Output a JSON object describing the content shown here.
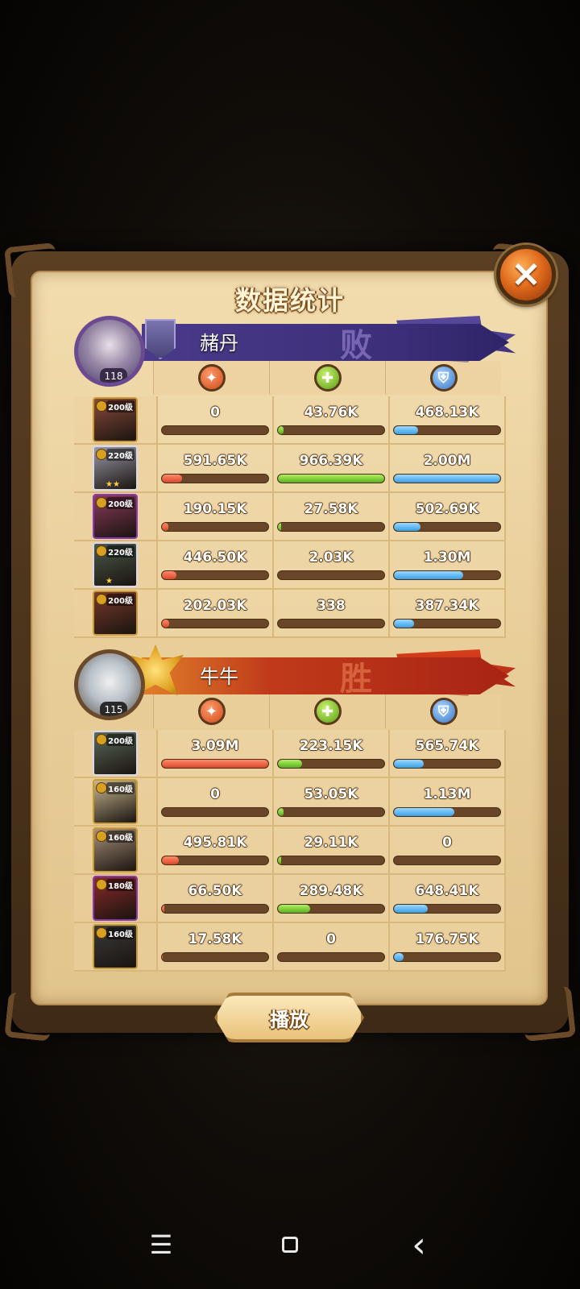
{
  "title": "数据统计",
  "close_icon": "×",
  "play_label": "播放",
  "stat_icons": [
    "damage-icon",
    "heal-icon",
    "shield-icon"
  ],
  "teams": [
    {
      "name": "赭丹",
      "result": "败",
      "avatar_level": "118",
      "heroes": [
        {
          "level": "200级",
          "stars": "",
          "damage": "0",
          "heal": "43.76K",
          "shield": "468.13K",
          "damage_pct": 0,
          "heal_pct": 5,
          "shield_pct": 23
        },
        {
          "level": "220级",
          "stars": "★★",
          "damage": "591.65K",
          "heal": "966.39K",
          "shield": "2.00M",
          "damage_pct": 19,
          "heal_pct": 100,
          "shield_pct": 100
        },
        {
          "level": "200级",
          "stars": "",
          "damage": "190.15K",
          "heal": "27.58K",
          "shield": "502.69K",
          "damage_pct": 6,
          "heal_pct": 3,
          "shield_pct": 25
        },
        {
          "level": "220级",
          "stars": "★",
          "damage": "446.50K",
          "heal": "2.03K",
          "shield": "1.30M",
          "damage_pct": 14,
          "heal_pct": 0,
          "shield_pct": 65
        },
        {
          "level": "200级",
          "stars": "",
          "damage": "202.03K",
          "heal": "338",
          "shield": "387.34K",
          "damage_pct": 7,
          "heal_pct": 0,
          "shield_pct": 19
        }
      ]
    },
    {
      "name": "牛牛",
      "result": "胜",
      "avatar_level": "115",
      "heroes": [
        {
          "level": "200级",
          "stars": "",
          "damage": "3.09M",
          "heal": "223.15K",
          "shield": "565.74K",
          "damage_pct": 100,
          "heal_pct": 23,
          "shield_pct": 28
        },
        {
          "level": "160级",
          "stars": "",
          "damage": "0",
          "heal": "53.05K",
          "shield": "1.13M",
          "damage_pct": 0,
          "heal_pct": 5,
          "shield_pct": 57
        },
        {
          "level": "160级",
          "stars": "",
          "damage": "495.81K",
          "heal": "29.11K",
          "shield": "0",
          "damage_pct": 16,
          "heal_pct": 3,
          "shield_pct": 0
        },
        {
          "level": "180级",
          "stars": "",
          "damage": "66.50K",
          "heal": "289.48K",
          "shield": "648.41K",
          "damage_pct": 2,
          "heal_pct": 30,
          "shield_pct": 32
        },
        {
          "level": "160级",
          "stars": "",
          "damage": "17.58K",
          "heal": "0",
          "shield": "176.75K",
          "damage_pct": 1,
          "heal_pct": 0,
          "shield_pct": 9
        }
      ]
    }
  ],
  "nav": {
    "menu_icon": "☰",
    "home_icon": "home-icon",
    "back_icon": "‹"
  }
}
